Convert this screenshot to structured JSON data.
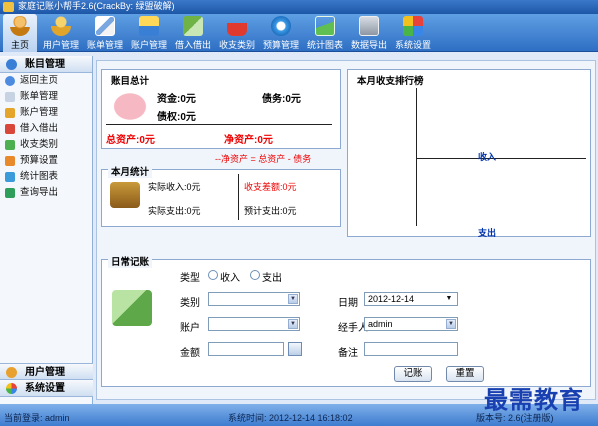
{
  "window": {
    "title": "家庭记账小帮手2.6(CrackBy: 绿盟破解)"
  },
  "toolbar": {
    "items": [
      {
        "label": "主页",
        "icon": "home-person-icon"
      },
      {
        "label": "用户管理",
        "icon": "user-icon"
      },
      {
        "label": "账单管理",
        "icon": "bill-icon"
      },
      {
        "label": "账户管理",
        "icon": "account-icon"
      },
      {
        "label": "借入借出",
        "icon": "lend-icon"
      },
      {
        "label": "收支类别",
        "icon": "basket-icon"
      },
      {
        "label": "预算管理",
        "icon": "budget-icon"
      },
      {
        "label": "统计图表",
        "icon": "chart-icon"
      },
      {
        "label": "数据导出",
        "icon": "export-icon"
      },
      {
        "label": "系统设置",
        "icon": "settings-icon"
      }
    ]
  },
  "sidebar": {
    "header": "账目管理",
    "items": [
      {
        "label": "返回主页",
        "icon": "back-icon"
      },
      {
        "label": "账单管理",
        "icon": "bill-icon"
      },
      {
        "label": "账户管理",
        "icon": "account-icon"
      },
      {
        "label": "借入借出",
        "icon": "lend-icon"
      },
      {
        "label": "收支类别",
        "icon": "category-icon"
      },
      {
        "label": "预算设置",
        "icon": "budget-icon"
      },
      {
        "label": "统计图表",
        "icon": "chart-icon"
      },
      {
        "label": "查询导出",
        "icon": "query-icon"
      }
    ],
    "footer": [
      {
        "label": "用户管理",
        "icon": "user-icon"
      },
      {
        "label": "系统设置",
        "icon": "settings-icon"
      }
    ]
  },
  "summary": {
    "title": "账目总计",
    "cash": "资金:0元",
    "debt": "债务:0元",
    "credit": "债权:0元",
    "total_assets": "总资产:0元",
    "net_assets": "净资产:0元",
    "formula": "--净资产 = 总资产 - 债务"
  },
  "monthly": {
    "title": "本月统计",
    "actual_income": "实际收入:0元",
    "actual_expense": "实际支出:0元",
    "balance_diff": "收支差额:0元",
    "planned_expense": "预计支出:0元"
  },
  "ranking": {
    "title": "本月收支排行榜",
    "income_label": "收入",
    "expense_label": "支出"
  },
  "daily": {
    "title": "日常记账",
    "type_label": "类型",
    "income_option": "收入",
    "expense_option": "支出",
    "category_label": "类别",
    "category_value": "",
    "date_label": "日期",
    "date_value": "2012-12-14",
    "account_label": "账户",
    "account_value": "",
    "handler_label": "经手人",
    "handler_value": "admin",
    "amount_label": "金额",
    "amount_value": "",
    "note_label": "备注",
    "note_value": "",
    "record_button": "记账",
    "reset_button": "重置"
  },
  "status": {
    "login": "当前登录: admin",
    "time": "系统时间: 2012-12-14 16:18:02",
    "version": "版本号: 2.6(注册版)"
  },
  "watermark": "最需教育",
  "colors": {
    "accent_blue": "#2f6fc4",
    "red_text": "#e00000",
    "link_blue": "#0033aa"
  }
}
